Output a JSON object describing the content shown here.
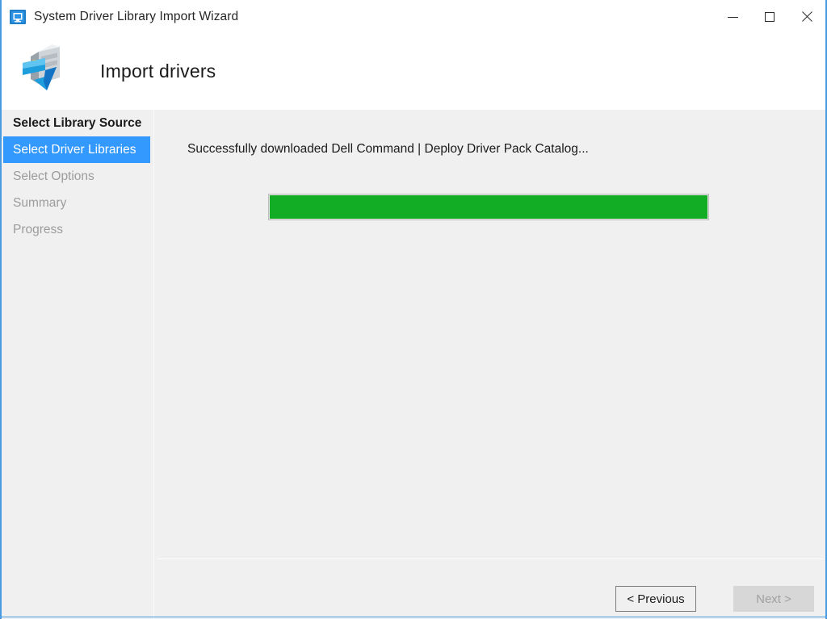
{
  "window": {
    "title": "System Driver Library Import Wizard",
    "title_icon": "computer-monitor-icon",
    "accent_color": "#4a9ae1",
    "background_color": "#f0f0f0",
    "controls": {
      "minimize_label": "Minimize",
      "maximize_label": "Maximize",
      "close_label": "Close"
    }
  },
  "header": {
    "title": "Import drivers",
    "icon": "server-import-arrow-icon"
  },
  "sidebar": {
    "items": [
      {
        "label": "Select Library Source",
        "state": "done"
      },
      {
        "label": "Select Driver Libraries",
        "state": "active"
      },
      {
        "label": "Select Options",
        "state": "pending"
      },
      {
        "label": "Summary",
        "state": "pending"
      },
      {
        "label": "Progress",
        "state": "pending"
      }
    ],
    "active_highlight_color": "#3399ff"
  },
  "main": {
    "status_text": "Successfully downloaded Dell Command | Deploy Driver Pack Catalog...",
    "progress": {
      "percent": 100,
      "fill_color": "#12ac25",
      "track_color": "#e6e6e6",
      "border_color": "#bcbcbc"
    }
  },
  "footer": {
    "previous_label": "< Previous",
    "next_label": "Next >",
    "previous_enabled": true,
    "next_enabled": false
  },
  "background_window": {
    "edge_text": "",
    "border_color": "#4a9ae1"
  }
}
